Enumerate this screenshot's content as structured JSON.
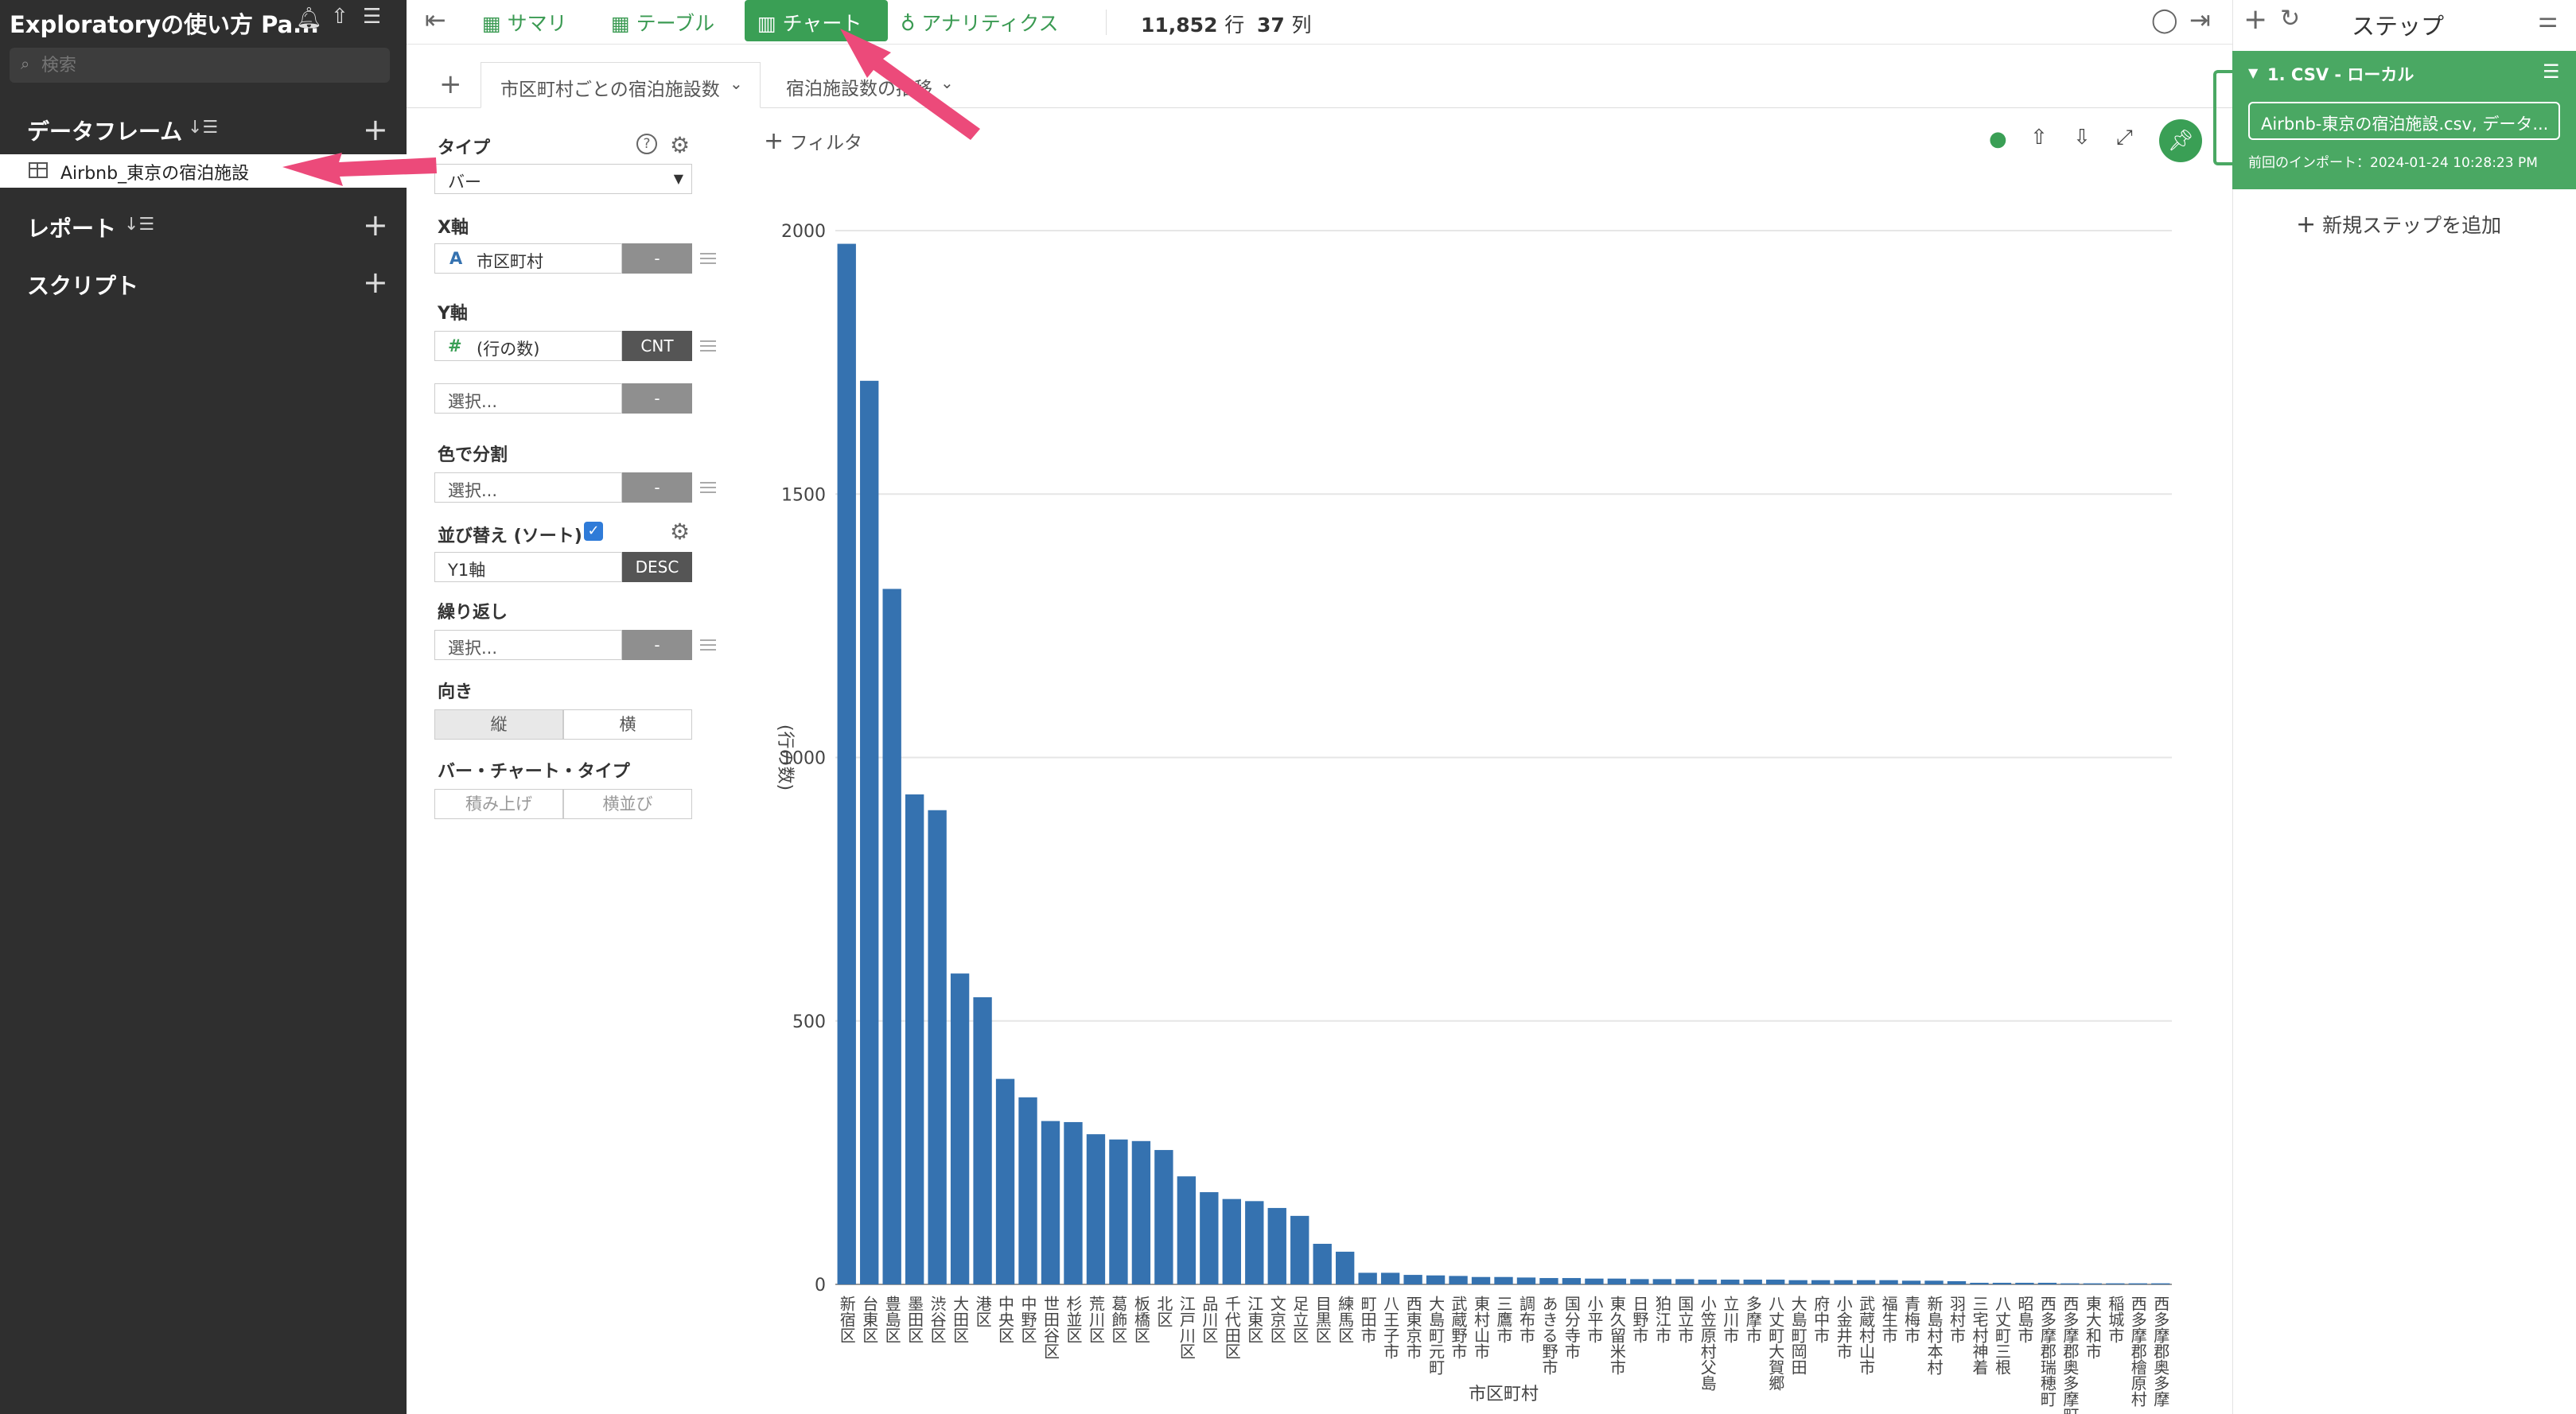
{
  "sidebar": {
    "project_title": "Exploratoryの使い方 Pa...",
    "search_placeholder": "検索",
    "sections": {
      "dataframe": "データフレーム",
      "report": "レポート",
      "script": "スクリプト"
    },
    "dataframe_item": "Airbnb_東京の宿泊施設"
  },
  "topbar": {
    "summary": "サマリ",
    "table": "テーブル",
    "chart": "チャート",
    "analytics": "アナリティクス",
    "rows_value": "11,852",
    "rows_unit": "行",
    "cols_value": "37",
    "cols_unit": "列",
    "steps_title": "ステップ"
  },
  "tabs": {
    "active": "市区町村ごとの宿泊施設数",
    "second": "宿泊施設数の推移"
  },
  "config": {
    "type_label": "タイプ",
    "type_value": "バー",
    "x_label": "X軸",
    "x_type": "A",
    "x_value": "市区町村",
    "x_btn": "-",
    "y_label": "Y軸",
    "y_type": "#",
    "y_value": "(行の数)",
    "y_btn": "CNT",
    "y2_value": "選択...",
    "y2_btn": "-",
    "color_label": "色で分割",
    "color_value": "選択...",
    "color_btn": "-",
    "sort_label": "並び替え (ソート)",
    "sort_value": "Y1軸",
    "sort_btn": "DESC",
    "repeat_label": "繰り返し",
    "repeat_value": "選択...",
    "repeat_btn": "-",
    "orient_label": "向き",
    "orient_vertical": "縦",
    "orient_horizontal": "横",
    "bar_type_label": "バー・チャート・タイプ",
    "bar_stacked": "積み上げ",
    "bar_side": "横並び"
  },
  "filter": "フィルタ",
  "steps": {
    "step1_title": "1. CSV - ローカル",
    "step1_source": "Airbnb-東京の宿泊施設.csv, データ...",
    "step1_import": "前回のインポート：2024-01-24 10:28:23 PM",
    "add_step": "新規ステップを追加"
  },
  "colors": {
    "accent": "#3a9f55",
    "bar": "#3572b0",
    "sidebar_bg": "#2f2f2f",
    "arrow": "#ec4a7a"
  },
  "chart_data": {
    "type": "bar",
    "xlabel": "市区町村",
    "ylabel": "(行の数)",
    "ylim": [
      0,
      2000
    ],
    "yticks": [
      0,
      500,
      1000,
      1500,
      2000
    ],
    "grid": true,
    "categories": [
      "新宿区",
      "台東区",
      "豊島区",
      "墨田区",
      "渋谷区",
      "大田区",
      "港区",
      "中央区",
      "中野区",
      "世田谷区",
      "杉並区",
      "荒川区",
      "葛飾区",
      "板橋区",
      "北区",
      "江戸川区",
      "品川区",
      "千代田区",
      "江東区",
      "文京区",
      "足立区",
      "目黒区",
      "練馬区",
      "町田市",
      "八王子市",
      "西東京市",
      "大島町元町",
      "武蔵野市",
      "東村山市",
      "三鷹市",
      "調布市",
      "あきる野市",
      "国分寺市",
      "小平市",
      "東久留米市",
      "日野市",
      "狛江市",
      "国立市",
      "小笠原村父島",
      "立川市",
      "多摩市",
      "八丈町大賀郷",
      "大島町岡田",
      "府中市",
      "小金井市",
      "武蔵村山市",
      "福生市",
      "青梅市",
      "新島村本村",
      "羽村市",
      "三宅村神着",
      "八丈町三根",
      "昭島市",
      "西多摩郡瑞穂町",
      "西多摩郡奥多摩町",
      "東大和市",
      "稲城市",
      "西多摩郡檜原村",
      "西多摩郡奥多摩"
    ],
    "values": [
      1975,
      1715,
      1320,
      930,
      900,
      590,
      545,
      390,
      355,
      310,
      308,
      285,
      275,
      272,
      255,
      205,
      175,
      162,
      158,
      145,
      130,
      77,
      62,
      22,
      22,
      18,
      17,
      16,
      14,
      14,
      13,
      12,
      12,
      11,
      11,
      10,
      10,
      10,
      9,
      9,
      9,
      9,
      8,
      8,
      8,
      8,
      8,
      7,
      7,
      6,
      3,
      3,
      3,
      3,
      2,
      2,
      2,
      2,
      2
    ]
  }
}
